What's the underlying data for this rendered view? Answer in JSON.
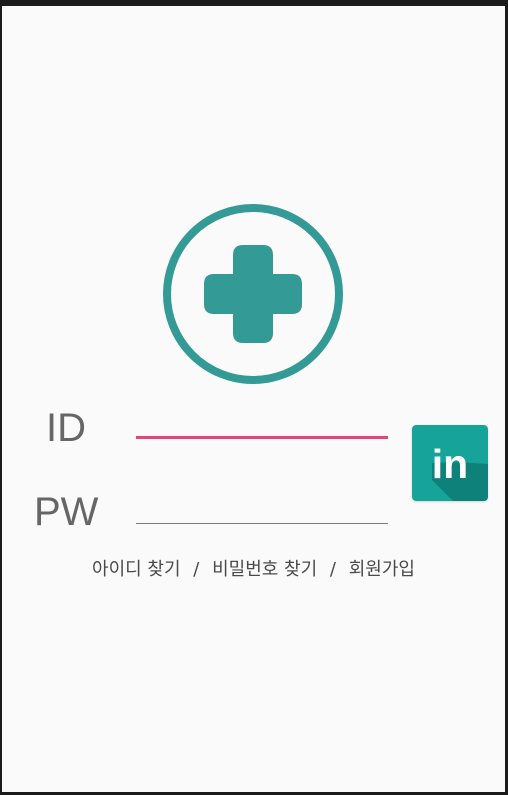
{
  "app": {
    "logo_icon": "medical-cross-icon",
    "accent_color": "#2f9b96",
    "highlight_color": "#e0457b"
  },
  "login": {
    "id_label": "ID",
    "pw_label": "PW",
    "id_value": "",
    "pw_value": ""
  },
  "social": {
    "linkedin_icon": "linkedin-icon",
    "linkedin_text": "in"
  },
  "links": {
    "find_id": "아이디 찾기",
    "separator": "/",
    "find_password": "비밀번호 찾기",
    "signup": "회원가입"
  }
}
